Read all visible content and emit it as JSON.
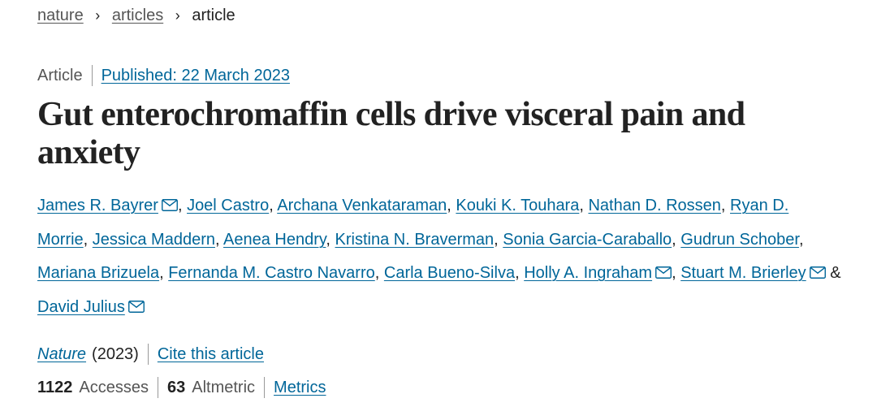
{
  "breadcrumb": {
    "items": [
      "nature",
      "articles",
      "article"
    ]
  },
  "article_meta": {
    "type": "Article",
    "published": "Published: 22 March 2023"
  },
  "title": "Gut enterochromaffin cells drive visceral pain and anxiety",
  "authors": [
    {
      "name": "James R. Bayrer",
      "email": true
    },
    {
      "name": "Joel Castro",
      "email": false
    },
    {
      "name": "Archana Venkataraman",
      "email": false
    },
    {
      "name": "Kouki K. Touhara",
      "email": false
    },
    {
      "name": "Nathan D. Rossen",
      "email": false
    },
    {
      "name": "Ryan D. Morrie",
      "email": false
    },
    {
      "name": "Jessica Maddern",
      "email": false
    },
    {
      "name": "Aenea Hendry",
      "email": false
    },
    {
      "name": "Kristina N. Braverman",
      "email": false
    },
    {
      "name": "Sonia Garcia-Caraballo",
      "email": false
    },
    {
      "name": "Gudrun Schober",
      "email": false
    },
    {
      "name": "Mariana Brizuela",
      "email": false
    },
    {
      "name": "Fernanda M. Castro Navarro",
      "email": false
    },
    {
      "name": "Carla Bueno-Silva",
      "email": false
    },
    {
      "name": "Holly A. Ingraham",
      "email": true
    },
    {
      "name": "Stuart M. Brierley",
      "email": true
    },
    {
      "name": "David Julius",
      "email": true
    }
  ],
  "journal": {
    "name": "Nature",
    "year": "(2023)",
    "cite": "Cite this article"
  },
  "stats": {
    "accesses_value": "1122",
    "accesses_label": "Accesses",
    "altmetric_value": "63",
    "altmetric_label": "Altmetric",
    "metrics_link": "Metrics"
  },
  "icons": {
    "email": "envelope-icon",
    "separator": "chevron-right-icon"
  },
  "colors": {
    "link": "#006699",
    "text": "#222222",
    "muted": "#555555"
  }
}
